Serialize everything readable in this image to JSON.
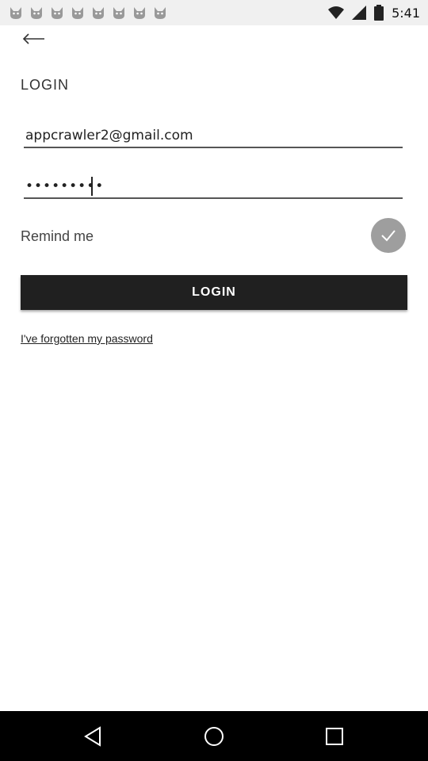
{
  "status_bar": {
    "time": "5:41",
    "notification_icons": [
      "cat-icon",
      "cat-icon",
      "cat-icon",
      "cat-icon",
      "cat-icon",
      "cat-icon",
      "cat-icon",
      "cat-icon"
    ],
    "right_icons": [
      "wifi-icon",
      "signal-icon",
      "battery-icon"
    ]
  },
  "header": {
    "back_icon": "arrow-left-icon",
    "title": "LOGIN"
  },
  "form": {
    "email_value": "appcrawler2@gmail.com",
    "password_value": "•••••••••",
    "remind_label": "Remind me",
    "remind_checked": true,
    "login_label": "LOGIN",
    "forgot_label": "I've forgotten my password"
  },
  "nav": {
    "buttons": [
      "back-triangle-icon",
      "home-circle-icon",
      "recents-square-icon"
    ]
  }
}
